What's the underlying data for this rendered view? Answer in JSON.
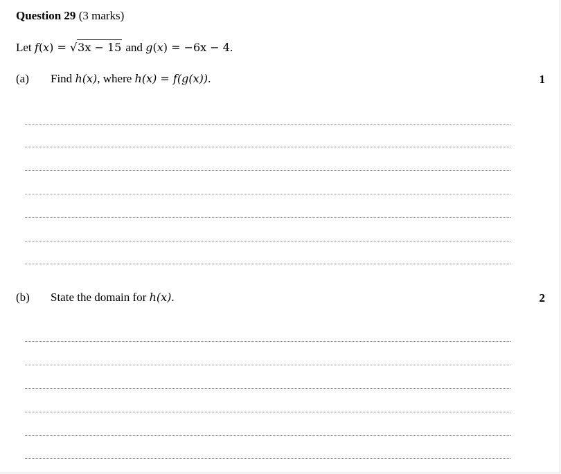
{
  "question": {
    "label": "Question 29",
    "marks_note": "(3 marks)"
  },
  "stem": {
    "let": "Let",
    "f_name": "f",
    "open1": "(",
    "x1": "x",
    "close1": ")",
    "eq1": "=",
    "radical": "√",
    "radicand": "3x − 15",
    "and": "and",
    "g_name": "g",
    "open2": "(",
    "x2": "x",
    "close2": ")",
    "eq2": "=",
    "g_expr": "−6x − 4",
    "period": "."
  },
  "part_a": {
    "label": "(a)",
    "text_prefix": "Find",
    "expr1": "h(x)",
    "text_mid": ", where",
    "expr2": "h(x) = f(g(x))",
    "period": ".",
    "marks": "1",
    "answer_lines": 7
  },
  "part_b": {
    "label": "(b)",
    "text_prefix": "State the domain for",
    "expr": "h(x)",
    "period": ".",
    "marks": "2",
    "answer_lines": 6
  }
}
